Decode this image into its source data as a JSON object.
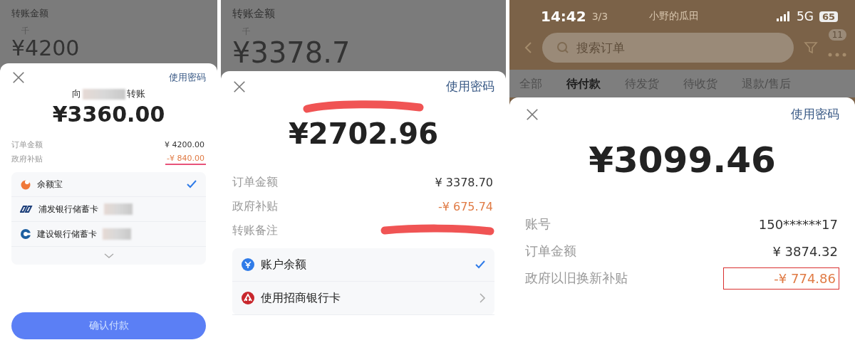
{
  "panels": [
    {
      "backdrop": {
        "label": "转账金额",
        "unit": "千",
        "amount": "¥4200"
      },
      "sheet": {
        "link": "使用密码",
        "payee": {
          "prefix": "向",
          "suffix": "转账",
          "blurred": true
        },
        "amount": "¥3360.00",
        "details": [
          {
            "label": "订单金额",
            "value": "¥ 4200.00",
            "discount": false,
            "underlined": false
          },
          {
            "label": "政府补贴",
            "value": "-¥ 840.00",
            "discount": true,
            "underlined": true
          }
        ],
        "methods": [
          {
            "kind": "fund",
            "name": "余额宝",
            "masked": false,
            "selected": true
          },
          {
            "kind": "spdb",
            "name": "浦发银行储蓄卡",
            "masked": true,
            "selected": false
          },
          {
            "kind": "ccb",
            "name": "建设银行储蓄卡",
            "masked": true,
            "selected": false
          }
        ],
        "more": true,
        "button": "确认付款"
      }
    },
    {
      "backdrop": {
        "label": "转账金额",
        "unit": "千",
        "amount": "¥3378.7"
      },
      "sheet": {
        "link": "使用密码",
        "payee_redacted": true,
        "amount": "¥2702.96",
        "details": [
          {
            "label": "订单金额",
            "value": "¥ 3378.70",
            "discount": false,
            "redacted": false
          },
          {
            "label": "政府补贴",
            "value": "-¥ 675.74",
            "discount": true,
            "redacted": false
          },
          {
            "label": "转账备注",
            "redacted": true
          }
        ],
        "methods": [
          {
            "kind": "balance",
            "name": "账户余额",
            "selected": true,
            "arrow": false
          },
          {
            "kind": "cmb",
            "name": "使用招商银行卡",
            "selected": false,
            "arrow": true
          }
        ]
      }
    },
    {
      "status": {
        "time": "14:42",
        "network": "5G",
        "battery": "65"
      },
      "header": {
        "page": "3/3",
        "title": "小野的瓜田",
        "search_placeholder": "搜索订单",
        "badge": "11"
      },
      "tabs": [
        {
          "label": "全部",
          "selected": false
        },
        {
          "label": "待付款",
          "selected": true
        },
        {
          "label": "待发货",
          "selected": false
        },
        {
          "label": "待收货",
          "selected": false
        },
        {
          "label": "退款/售后",
          "selected": false
        }
      ],
      "sheet": {
        "link": "使用密码",
        "amount": "¥3099.46",
        "details": [
          {
            "label": "账号",
            "value": "150******17",
            "discount": false,
            "boxed": false
          },
          {
            "label": "订单金额",
            "value": "¥ 3874.32",
            "discount": false,
            "boxed": false
          },
          {
            "label": "政府以旧换新补贴",
            "value": "-¥ 774.86",
            "discount": true,
            "boxed": true
          }
        ]
      }
    }
  ]
}
